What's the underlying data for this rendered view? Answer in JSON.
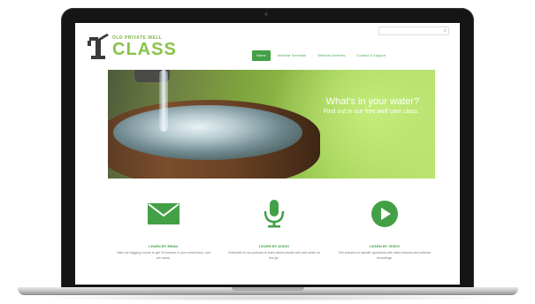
{
  "site": {
    "logo_small": "OLD PRIVATE WELL",
    "logo_big": "CLASS",
    "search_placeholder": ""
  },
  "nav": {
    "items": [
      {
        "label": "Home",
        "active": true
      },
      {
        "label": "Webinar Schedule",
        "active": false
      },
      {
        "label": "Webinar Archives",
        "active": false
      },
      {
        "label": "Contact & Support",
        "active": false
      }
    ]
  },
  "hero": {
    "title": "What's in your water?",
    "subtitle": "Find out in our free well care class."
  },
  "features": [
    {
      "icon": "envelope-icon",
      "title": "LEARN BY EMAIL",
      "desc": "Take our flagging course to get 10 lessons in your email inbox, one per week."
    },
    {
      "icon": "microphone-icon",
      "title": "LEARN BY AUDIO",
      "desc": "Subscribe to our podcast to learn about private well care while on the go."
    },
    {
      "icon": "play-icon",
      "title": "LEARN BY VIDEO",
      "desc": "Get answers to specific questions with video lessons and webinar recordings."
    }
  ],
  "colors": {
    "brand_green": "#43a047",
    "logo_green": "#8bc34a"
  }
}
